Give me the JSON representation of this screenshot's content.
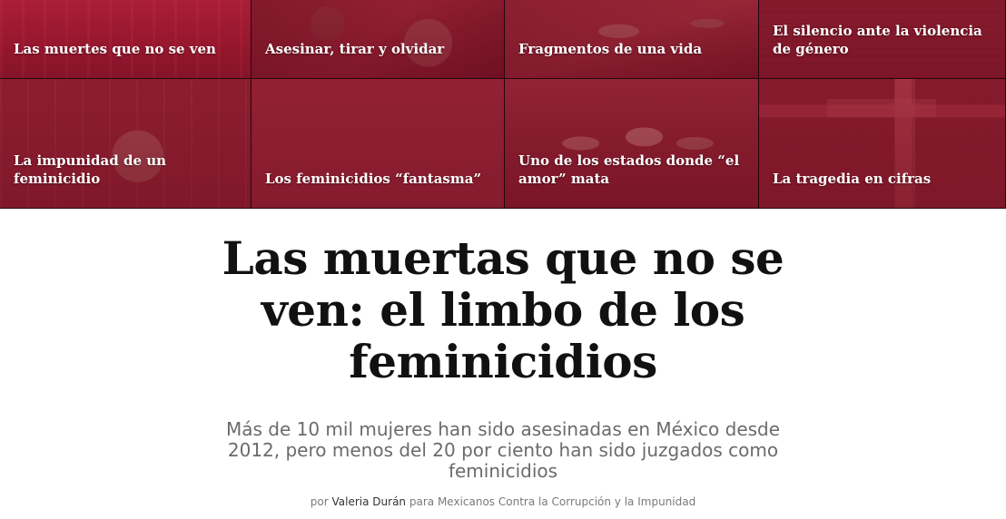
{
  "nav": {
    "tiles": [
      {
        "label": "Las muertes que no se ven"
      },
      {
        "label": "Asesinar, tirar y olvidar"
      },
      {
        "label": "Fragmentos de una vida"
      },
      {
        "label": "El silencio ante la violencia de género"
      },
      {
        "label": "La impunidad de un feminicidio"
      },
      {
        "label": "Los feminicidios “fantasma”"
      },
      {
        "label": "Uno de los estados donde “el amor” mata"
      },
      {
        "label": "La tragedia en cifras"
      }
    ]
  },
  "article": {
    "title": "Las muertas que no se ven: el limbo de los feminicidios",
    "subtitle": "Más de 10 mil mujeres han sido asesinadas en México desde 2012, pero menos del 20 por ciento han sido juzgados como feminicidios",
    "byline": {
      "prefix": "por",
      "author": "Valeria Durán",
      "suffix": "para Mexicanos Contra la Corrupción y la Impunidad"
    }
  },
  "colors": {
    "tile_tint": "#96162c",
    "headline": "#111111",
    "subtitle": "#6b6b6b"
  }
}
